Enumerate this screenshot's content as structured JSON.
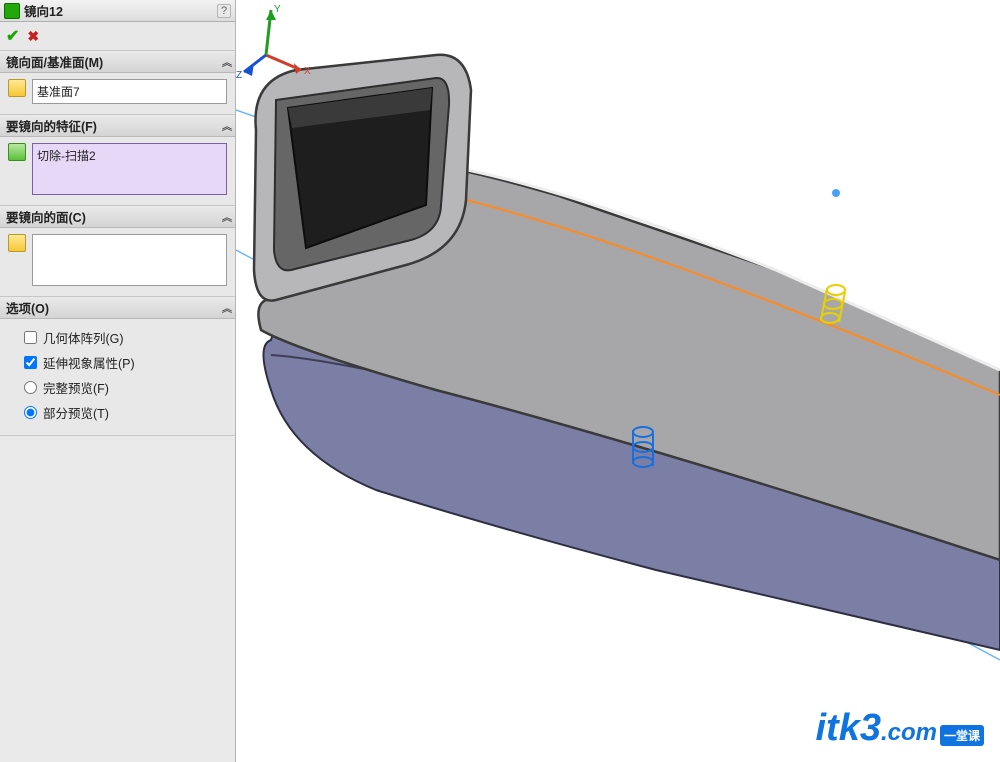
{
  "panel": {
    "title": "镜向12",
    "help": "?",
    "ok": "✔",
    "cancel": "✖",
    "sections": {
      "mirror_plane": {
        "label": "镜向面/基准面(M)",
        "value": "基准面7"
      },
      "features": {
        "label": "要镜向的特征(F)",
        "value": "切除-扫描2"
      },
      "faces": {
        "label": "要镜向的面(C)",
        "value": ""
      },
      "options": {
        "label": "选项(O)",
        "geo_pattern": {
          "label": "几何体阵列(G)",
          "checked": false
        },
        "prop_visual": {
          "label": "延伸视象属性(P)",
          "checked": true
        },
        "full_preview": {
          "label": "完整预览(F)"
        },
        "part_preview": {
          "label": "部分预览(T)"
        },
        "preview_selected": "part"
      }
    }
  },
  "triad": {
    "x": "X",
    "y": "Y",
    "z": "Z"
  },
  "watermark": {
    "brand": "itk3",
    "dom": ".com",
    "tag": "一堂课"
  }
}
